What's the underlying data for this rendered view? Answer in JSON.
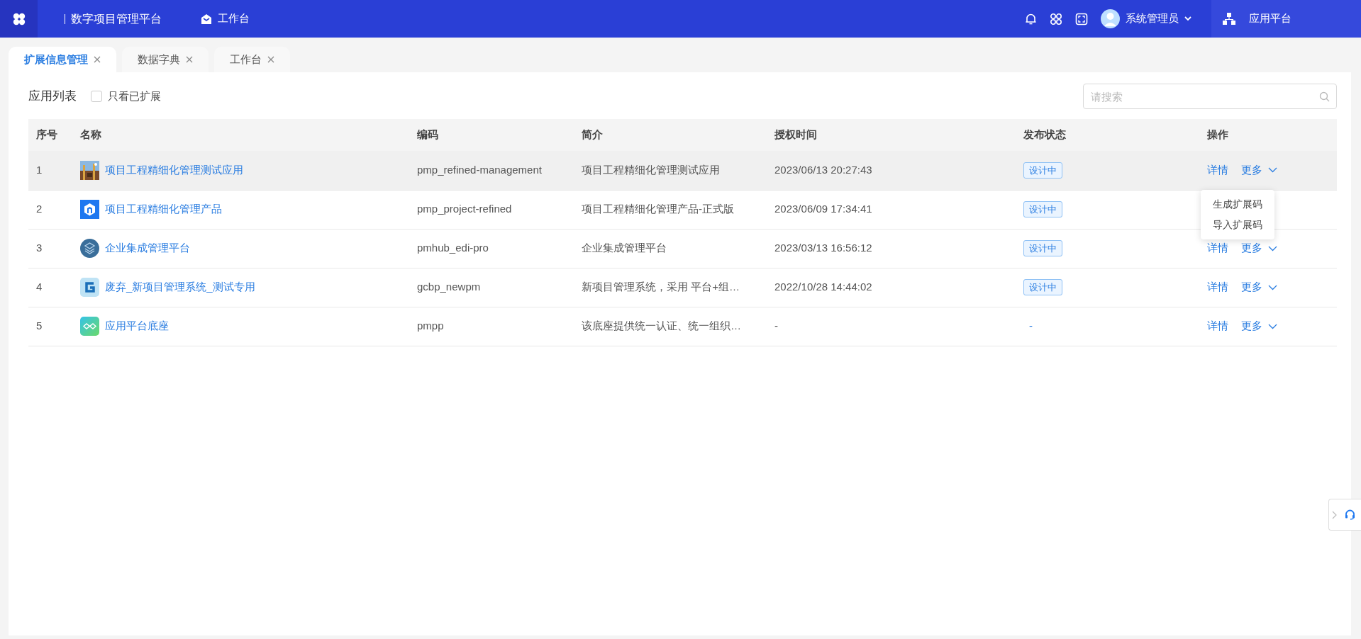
{
  "header": {
    "platform_name": "数字项目管理平台",
    "workbench": "工作台",
    "user_name": "系统管理员",
    "app_platform": "应用平台"
  },
  "tabs": [
    {
      "label": "扩展信息管理",
      "selected": true
    },
    {
      "label": "数据字典",
      "selected": false
    },
    {
      "label": "工作台",
      "selected": false
    }
  ],
  "toolbar": {
    "title": "应用列表",
    "filter": {
      "label": "只看已扩展",
      "checked": false
    },
    "search": {
      "placeholder": "请搜索"
    }
  },
  "table": {
    "columns": [
      "序号",
      "名称",
      "编码",
      "简介",
      "授权时间",
      "发布状态",
      "操作"
    ],
    "rows": [
      {
        "index": "1",
        "name": "项目工程精细化管理测试应用",
        "code": "pmp_refined-management",
        "description": "项目工程精细化管理测试应用",
        "auth_time": "2023/06/13 20:27:43",
        "status": {
          "kind": "tag",
          "text": "设计中"
        },
        "highlighted": true,
        "actions": {
          "detail": "详情",
          "more": "更多"
        },
        "menu": [
          "生成扩展码",
          "导入扩展码"
        ]
      },
      {
        "index": "2",
        "name": "项目工程精细化管理产品",
        "code": "pmp_project-refined",
        "description": "项目工程精细化管理产品-正式版",
        "auth_time": "2023/06/09 17:34:41",
        "status": {
          "kind": "tag",
          "text": "设计中"
        },
        "highlighted": false
      },
      {
        "index": "3",
        "name": "企业集成管理平台",
        "code": "pmhub_edi-pro",
        "description": "企业集成管理平台",
        "auth_time": "2023/03/13 16:56:12",
        "status": {
          "kind": "tag",
          "text": "设计中"
        },
        "highlighted": false,
        "actions": {
          "detail": "详情",
          "more": "更多"
        }
      },
      {
        "index": "4",
        "name": "废弃_新项目管理系统_测试专用",
        "code": "gcbp_newpm",
        "description": "新项目管理系统，采用 平台+组…",
        "auth_time": "2022/10/28 14:44:02",
        "status": {
          "kind": "tag",
          "text": "设计中"
        },
        "highlighted": false,
        "actions": {
          "detail": "详情",
          "more": "更多"
        }
      },
      {
        "index": "5",
        "name": "应用平台底座",
        "code": "pmpp",
        "description": "该底座提供统一认证、统一组织…",
        "auth_time": "-",
        "status": {
          "kind": "plain",
          "text": "-"
        },
        "highlighted": false,
        "actions": {
          "detail": "详情",
          "more": "更多"
        }
      }
    ]
  }
}
